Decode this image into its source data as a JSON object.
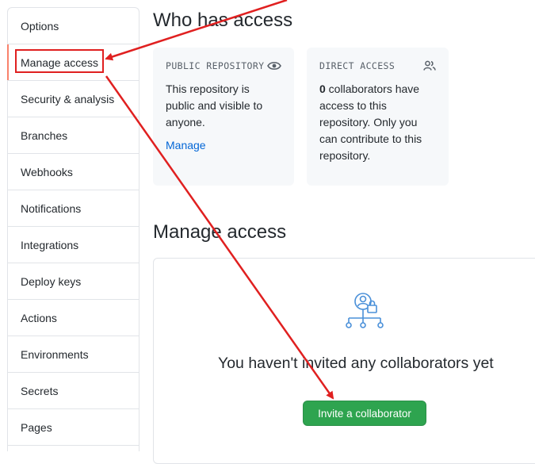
{
  "sidebar": {
    "items": [
      {
        "label": "Options"
      },
      {
        "label": "Manage access"
      },
      {
        "label": "Security & analysis"
      },
      {
        "label": "Branches"
      },
      {
        "label": "Webhooks"
      },
      {
        "label": "Notifications"
      },
      {
        "label": "Integrations"
      },
      {
        "label": "Deploy keys"
      },
      {
        "label": "Actions"
      },
      {
        "label": "Environments"
      },
      {
        "label": "Secrets"
      },
      {
        "label": "Pages"
      }
    ],
    "selected_index": 1
  },
  "who_has_access": {
    "title": "Who has access",
    "public_card": {
      "label": "PUBLIC REPOSITORY",
      "icon": "eye-icon",
      "text": "This repository is public and visible to anyone.",
      "link": "Manage"
    },
    "direct_card": {
      "label": "DIRECT ACCESS",
      "icon": "people-icon",
      "count": "0",
      "text_rest": " collaborators have access to this repository. Only you can contribute to this repository."
    }
  },
  "manage_access": {
    "title": "Manage access",
    "empty_icon": "collaborators-lock-icon",
    "empty_message": "You haven't invited any collaborators yet",
    "invite_button": "Invite a collaborator"
  },
  "annotations": {
    "color": "#e02020"
  },
  "colors": {
    "accent_green": "#2ea44f",
    "link_blue": "#0366d6",
    "selected_marker": "#f9826c"
  }
}
